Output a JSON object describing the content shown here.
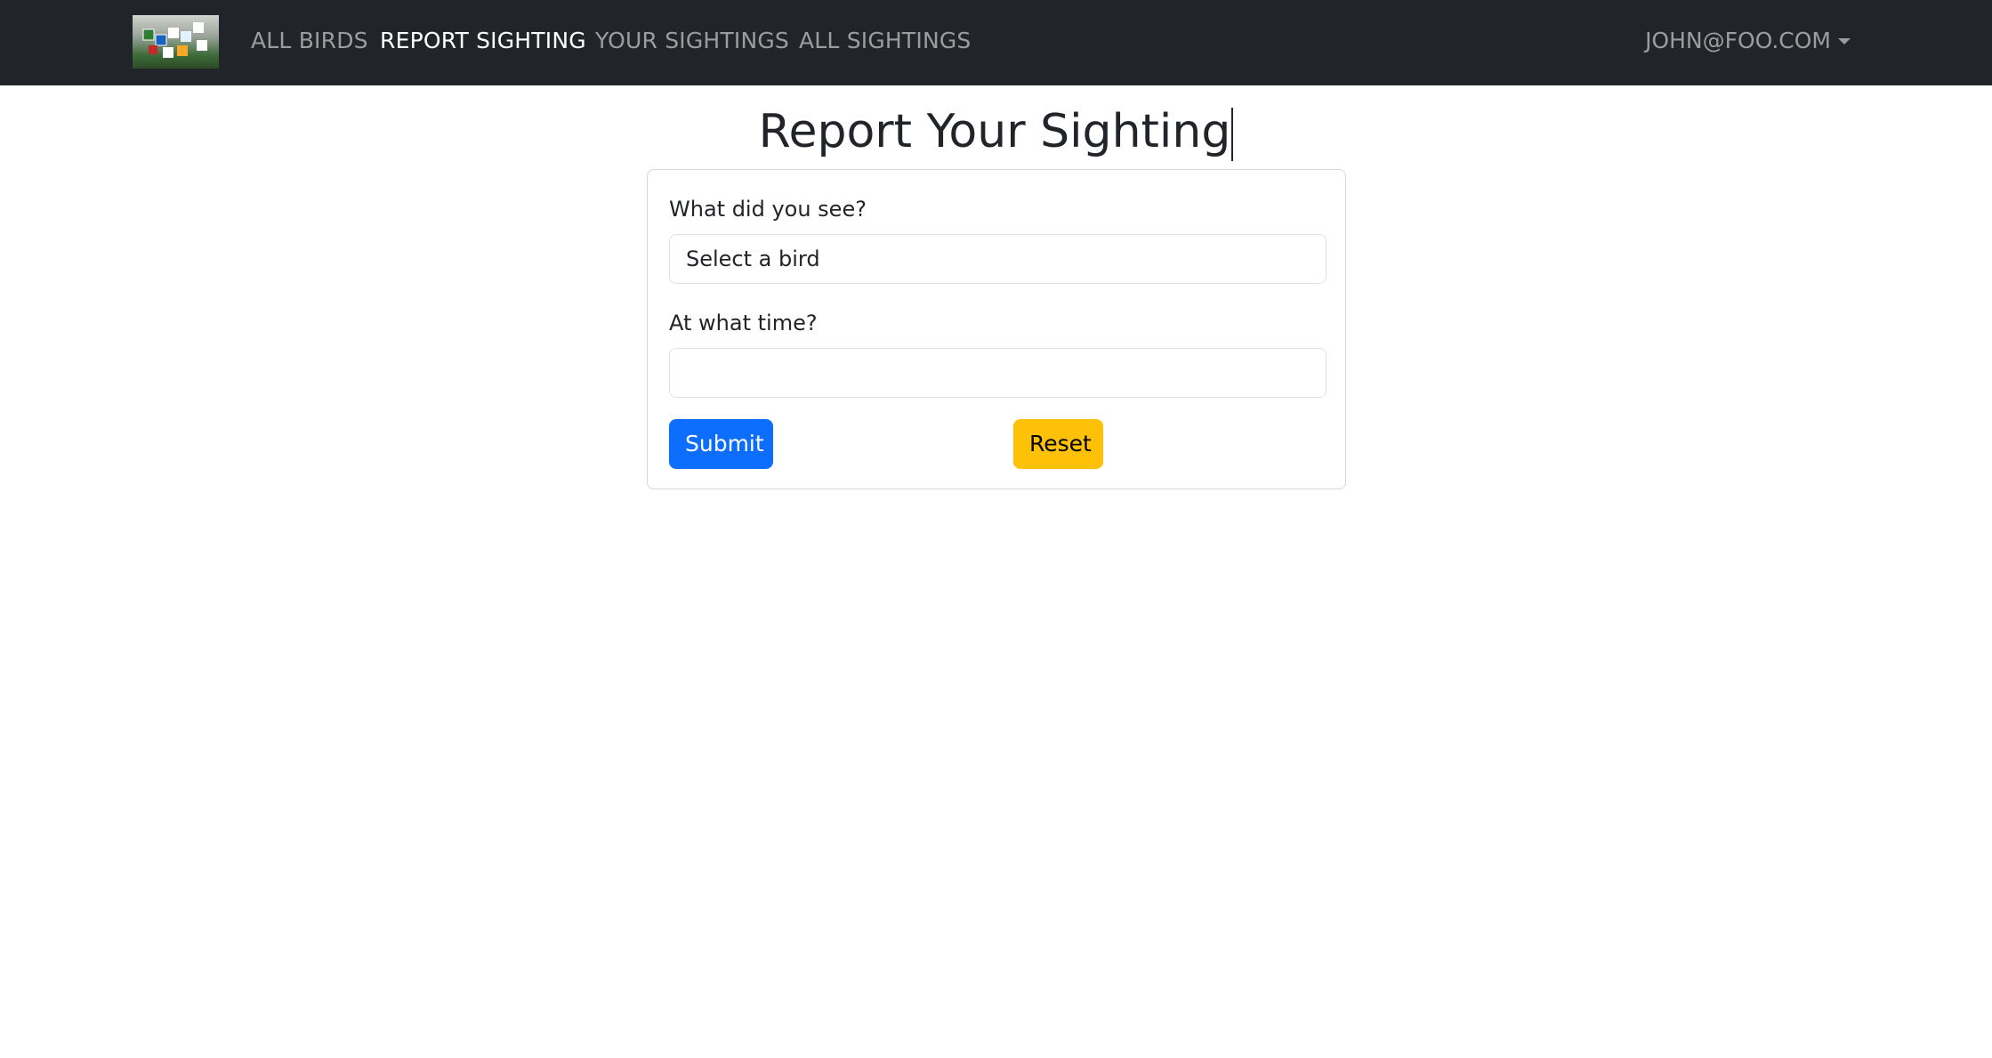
{
  "navbar": {
    "links": [
      {
        "label": "ALL BIRDS"
      },
      {
        "label": "REPORT SIGHTING"
      },
      {
        "label": "YOUR SIGHTINGS"
      },
      {
        "label": "ALL SIGHTINGS"
      }
    ],
    "active_link": "REPORT SIGHTING",
    "user": "JOHN@FOO.COM"
  },
  "page": {
    "title": "Report Your Sighting"
  },
  "form": {
    "bird_label": "What did you see?",
    "bird_select_value": "Select a bird",
    "time_label": "At what time?",
    "time_value": "",
    "submit_label": "Submit",
    "reset_label": "Reset"
  },
  "colors": {
    "navbar_bg": "#212529",
    "primary": "#0d6efd",
    "warning": "#ffc107"
  }
}
